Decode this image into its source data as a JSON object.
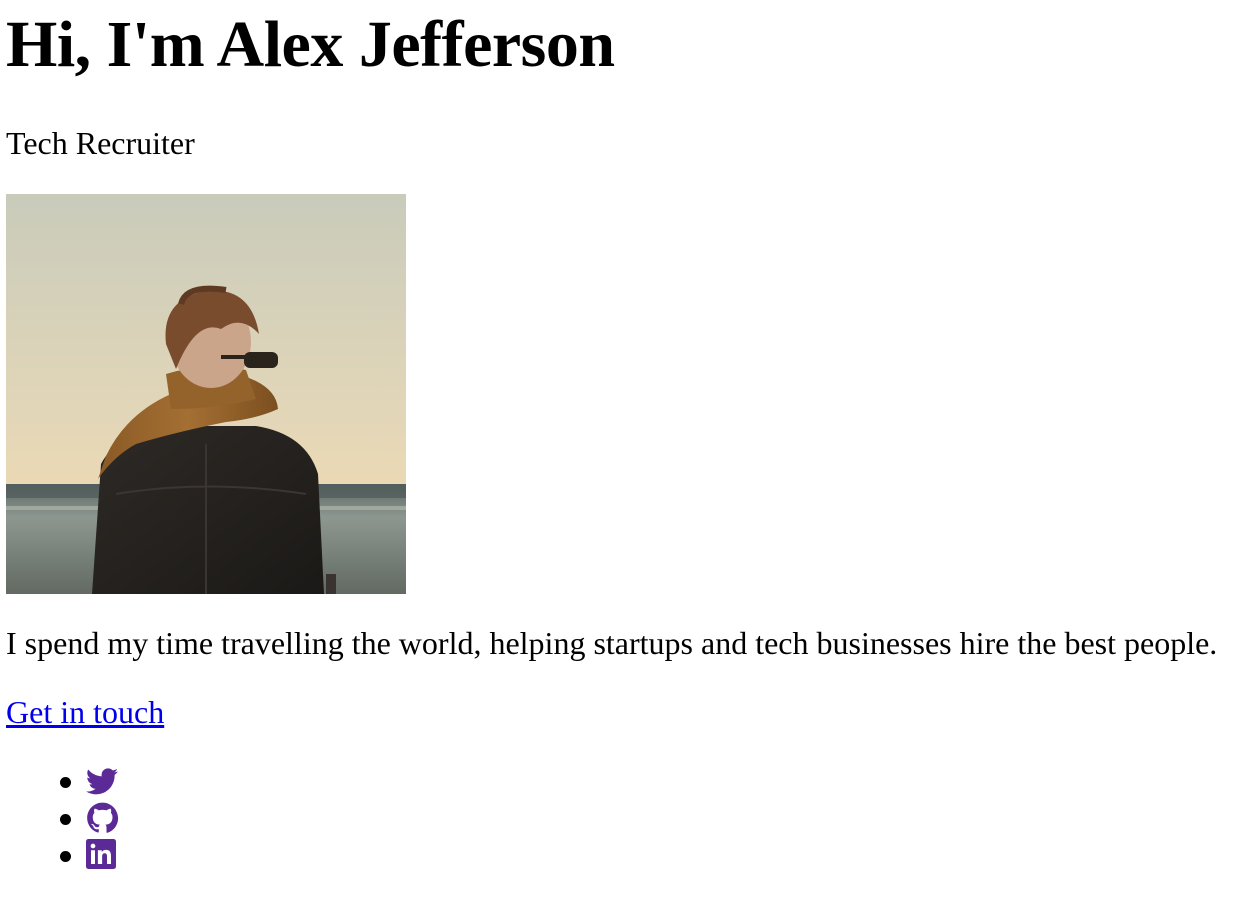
{
  "hero": {
    "title": "Hi, I'm Alex Jefferson",
    "subtitle": "Tech Recruiter",
    "photo_alt": "Person with scarf and sunglasses looking at the sea"
  },
  "bio": {
    "text": "I spend my time travelling the world, helping startups and tech businesses hire the best people."
  },
  "cta": {
    "label": "Get in touch"
  },
  "social": {
    "icon_color": "#5b2a96",
    "items": [
      {
        "icon": "twitter-icon",
        "label": "Twitter"
      },
      {
        "icon": "github-icon",
        "label": "GitHub"
      },
      {
        "icon": "linkedin-icon",
        "label": "LinkedIn"
      }
    ]
  },
  "colors": {
    "link": "#0000ee",
    "text": "#000000",
    "background": "#ffffff"
  }
}
